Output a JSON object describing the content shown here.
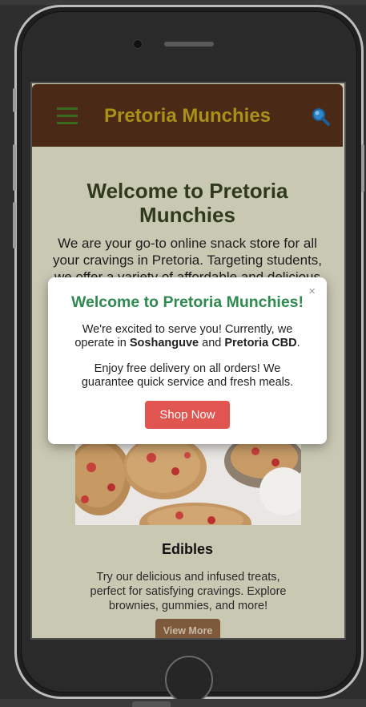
{
  "header": {
    "title": "Pretoria Munchies",
    "menu_icon": "hamburger-menu-icon",
    "search_icon": "search-icon"
  },
  "hero": {
    "title": "Welcome to Pretoria Munchies",
    "text": "We are your go-to online snack store for all your cravings in Pretoria. Targeting students, we offer a variety of affordable and delicious"
  },
  "product": {
    "name": "Edibles",
    "description": "Try our delicious and infused treats, perfect for satisfying cravings. Explore brownies, gummies, and more!",
    "button_label": "View More"
  },
  "modal": {
    "close_label": "×",
    "title": "Welcome to Pretoria Munchies!",
    "p1_before": "We're excited to serve you! Currently, we operate in ",
    "p1_loc1": "Soshanguve",
    "p1_and": " and ",
    "p1_loc2": "Pretoria CBD",
    "p1_end": ".",
    "p2": "Enjoy free delivery on all orders! We guarantee quick service and fresh meals.",
    "button_label": "Shop Now"
  },
  "colors": {
    "header_bg": "#4a2a16",
    "title_gold": "#a8901a",
    "modal_title_green": "#2e8a4f",
    "shop_button": "#e0554f",
    "view_more_button": "#7d5a3b"
  }
}
